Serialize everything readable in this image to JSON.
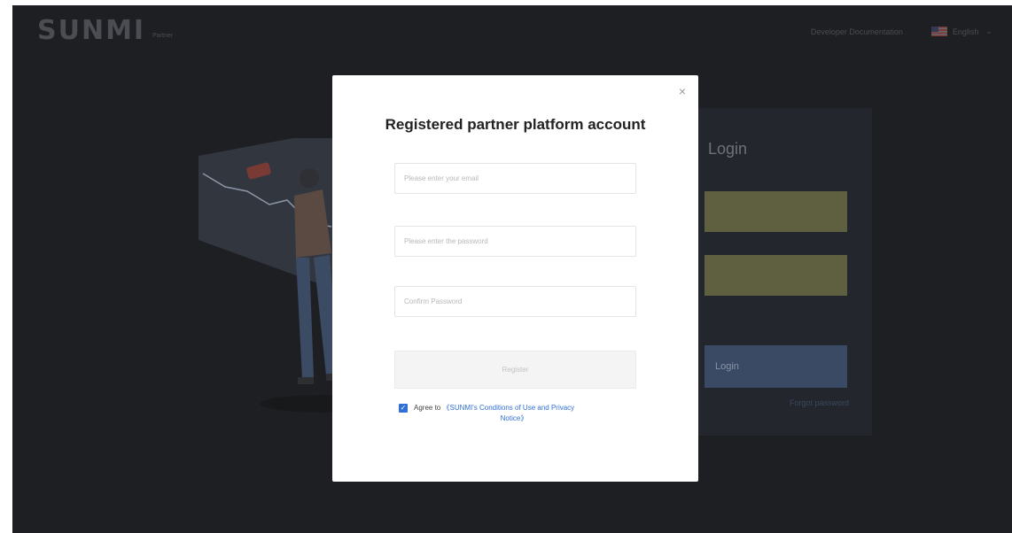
{
  "header": {
    "logo_text": "SUNMI",
    "logo_sub": "Partner",
    "dev_doc_label": "Developer Documentation",
    "language_label": "English",
    "flag_icon": "us-flag-icon",
    "chevron_icon": "chevron-down-icon"
  },
  "login_panel": {
    "title": "Login",
    "login_button": "Login",
    "forgot_label": "Forgot password"
  },
  "modal": {
    "title": "Registered partner platform account",
    "close_glyph": "×",
    "email_placeholder": "Please enter your email",
    "password_placeholder": "Please enter the password",
    "confirm_placeholder": "Confirm Password",
    "register_label": "Register",
    "agree_prefix": "Agree to",
    "agree_link_line1": "《SUNMI's Conditions of Use and Privacy",
    "agree_link_line2": "Notice》",
    "agree_checked": true
  },
  "colors": {
    "background": "#1e1f22",
    "accent": "#2f6fd6",
    "login_button": "#3b4a64",
    "field_fill": "#5f6040"
  }
}
